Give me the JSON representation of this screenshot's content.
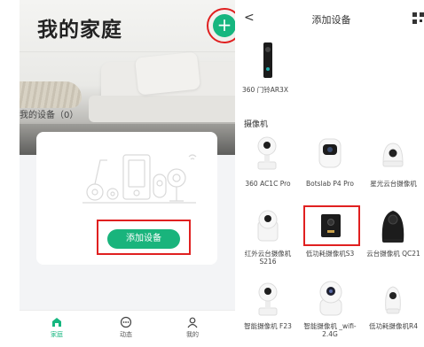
{
  "left_screen": {
    "title": "我的家庭",
    "add_button_symbol": "+",
    "my_devices_label": "我的设备（0）",
    "empty_card": {
      "add_device_button": "添加设备",
      "illustration": "smart-home-devices-outline"
    },
    "tabbar": {
      "items": [
        {
          "label": "家庭",
          "icon": "home-icon",
          "active": true
        },
        {
          "label": "动态",
          "icon": "activity-icon",
          "active": false
        },
        {
          "label": "我的",
          "icon": "profile-icon",
          "active": false
        }
      ]
    }
  },
  "right_screen": {
    "nav": {
      "back_symbol": "<",
      "title": "添加设备",
      "scan_icon": "qr-scan-icon"
    },
    "top_device": {
      "label": "360 门铃AR3X"
    },
    "section_title": "摄像机",
    "devices": [
      {
        "label": "360 AC1C Pro"
      },
      {
        "label": "Botslab P4 Pro"
      },
      {
        "label": "星光云台摄像机"
      },
      {
        "label": "红外云台摄像机 S216"
      },
      {
        "label": "低功耗摄像机S3"
      },
      {
        "label": "云台摄像机 QC21"
      },
      {
        "label": "智能摄像机 F23"
      },
      {
        "label": "智能摄像机 _wifi-2.4G"
      },
      {
        "label": "低功耗摄像机R4"
      }
    ]
  },
  "colors": {
    "accent_green": "#16b67f",
    "highlight_red": "#e02020"
  }
}
